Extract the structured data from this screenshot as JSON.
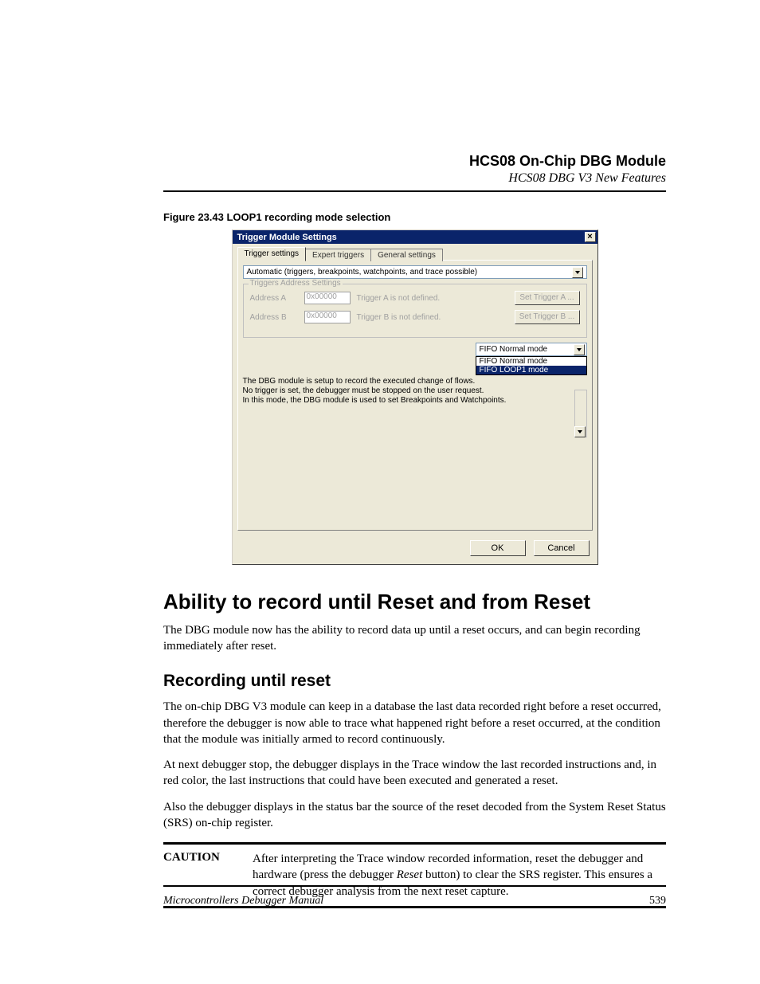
{
  "header": {
    "title": "HCS08 On-Chip DBG Module",
    "subtitle": "HCS08 DBG V3 New Features"
  },
  "figure": {
    "caption": "Figure 23.43  LOOP1 recording mode selection"
  },
  "dialog": {
    "title": "Trigger Module Settings",
    "close": "×",
    "tabs": [
      "Trigger settings",
      "Expert triggers",
      "General settings"
    ],
    "mode_combo": "Automatic (triggers, breakpoints, watchpoints, and trace possible)",
    "fieldset_legend": "Triggers Address Settings",
    "addr_a": {
      "label": "Address A",
      "value": "0x00000",
      "status": "Trigger A is not defined.",
      "button": "Set Trigger A ..."
    },
    "addr_b": {
      "label": "Address B",
      "value": "0x00000",
      "status": "Trigger B is not defined.",
      "button": "Set Trigger B ..."
    },
    "fifo_selected": "FIFO Normal mode",
    "fifo_options": [
      "FIFO Normal mode",
      "FIFO LOOP1 mode"
    ],
    "desc_line1": "The DBG module is setup to record the executed change of flows.",
    "desc_line2": "No trigger is set, the debugger must be stopped on the user request.",
    "desc_line3": "In this mode, the DBG module is used to set Breakpoints and Watchpoints.",
    "ok": "OK",
    "cancel": "Cancel"
  },
  "content": {
    "h2": "Ability to record until Reset and from Reset",
    "p1": "The DBG module now has the ability to record data up until a reset occurs, and can begin recording immediately after reset.",
    "h3": "Recording until reset",
    "p2": "The on-chip DBG V3 module can keep in a database the last data recorded right before a reset occurred, therefore the debugger is now able to trace what happened right before a reset occurred, at the condition that the module was initially armed to record continuously.",
    "p3": "At next debugger stop, the debugger displays in the Trace window the last recorded instructions and, in red color, the last instructions that could have been executed and generated a reset.",
    "p4": "Also the debugger displays in the status bar the source of the reset decoded from the System Reset Status (SRS) on-chip register.",
    "caution_label": "CAUTION",
    "caution_text_pre": "After interpreting the Trace window recorded information, reset the debugger and hardware (press the debugger ",
    "caution_text_ital": "Reset",
    "caution_text_post": " button) to clear the SRS register. This ensures a correct debugger analysis from the next reset capture."
  },
  "footer": {
    "manual": "Microcontrollers Debugger Manual",
    "page": "539"
  }
}
